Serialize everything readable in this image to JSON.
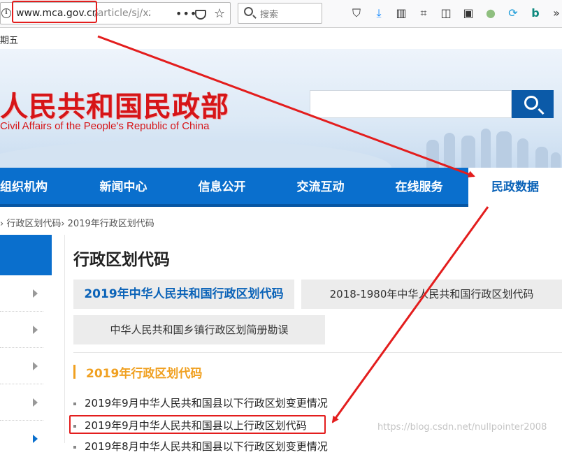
{
  "browser": {
    "url_domain": "www.mca.gov.cn",
    "url_path": "/article/sj/xz",
    "overflow_menu": "•••",
    "search_placeholder": "搜索"
  },
  "header": {
    "date_fragment": "期五",
    "site_title": "人民共和国民政部",
    "site_subtitle": "Civil Affairs of the People's Republic of China"
  },
  "nav": {
    "items": [
      "组织机构",
      "新闻中心",
      "信息公开",
      "交流互动",
      "在线服务",
      "民政数据"
    ],
    "active_index": 5
  },
  "breadcrumb": {
    "text": "› 行政区划代码› 2019年行政区划代码"
  },
  "main": {
    "heading": "行政区划代码",
    "tabs": [
      "2019年中华人民共和国行政区划代码",
      "2018-1980年中华人民共和国行政区划代码",
      "中华人民共和国乡镇行政区划简册勘误"
    ],
    "section_title": "2019年行政区划代码",
    "list": [
      "2019年9月中华人民共和国县以下行政区划变更情况",
      "2019年9月中华人民共和国县以上行政区划代码",
      "2019年8月中华人民共和国县以下行政区划变更情况"
    ]
  },
  "watermark": "https://blog.csdn.net/nullpointer2008",
  "colors": {
    "accent_blue": "#0a6fcd",
    "title_red": "#d61518",
    "section_orange": "#f0a020",
    "annotation_red": "#e31d1d"
  }
}
